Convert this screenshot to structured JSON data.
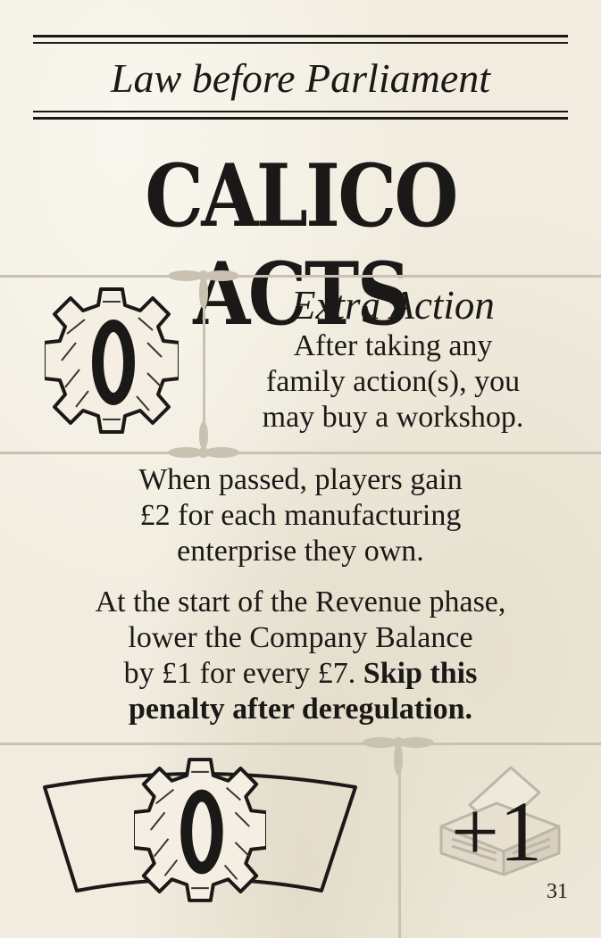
{
  "card": {
    "subtitle": "Law before Parliament",
    "title": "CALICO ACTS",
    "extra_action": {
      "title": "Extra Action",
      "lines": [
        "After taking any",
        "family action(s), you",
        "may buy a workshop."
      ],
      "icon": "gear-icon"
    },
    "passed_effect": {
      "lines": [
        "When passed, players gain",
        "£2 for each manufacturing",
        "enterprise they own."
      ]
    },
    "revenue_rule": {
      "lines": [
        "At the start of the Revenue phase,",
        "lower the Company Balance",
        "by £1 for every £7. "
      ],
      "bold_lines": [
        "Skip this",
        "penalty after deregulation."
      ]
    },
    "banner_icon": "gear-icon",
    "vote_bonus": {
      "value": "+1",
      "icon": "ballot-box-icon"
    },
    "page_number": "31"
  },
  "colors": {
    "ink": "#1b1917",
    "paper": "#f1ecdf",
    "guide": "#c9c2b3"
  }
}
